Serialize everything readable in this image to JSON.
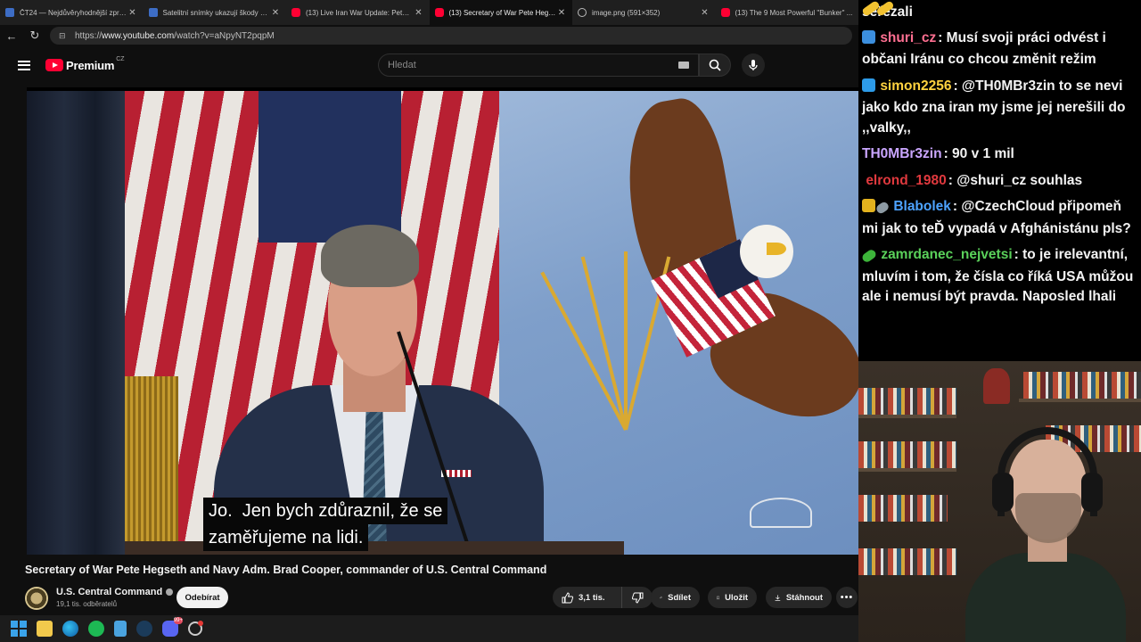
{
  "browser": {
    "tabs": [
      {
        "label": "ČT24 — Nejdůvěryhodnější zpravodajství",
        "icon": "ct24-favicon"
      },
      {
        "label": "Satelitní snímky ukazují škody po ...",
        "icon": "ct24-favicon"
      },
      {
        "label": "(13) Live Iran War Update: Pete Heg...",
        "icon": "youtube-favicon"
      },
      {
        "label": "(13) Secretary of War Pete Hegseth ...",
        "icon": "youtube-favicon",
        "active": true
      },
      {
        "label": "image.png (591×352)",
        "icon": "globe-favicon"
      },
      {
        "label": "(13) The 9 Most Powerful \"Bunker\" ...",
        "icon": "youtube-favicon"
      }
    ],
    "url_prefix": "https://",
    "url_host": "www.youtube.com",
    "url_path": "/watch?v=aNpyNT2pqpM"
  },
  "youtube": {
    "logo_text": "Premium",
    "country_code": "CZ",
    "search_placeholder": "Hledat",
    "video": {
      "subtitle_line1": "Jo.  Jen bych zdůraznil, že se",
      "subtitle_line2": "zaměřujeme na lidi.",
      "title": "Secretary of War Pete Hegseth and Navy Adm. Brad Cooper, commander of U.S. Central Command"
    },
    "channel": {
      "name": "U.S. Central Command",
      "subscribers": "19,1 tis. odběratelů",
      "subscribe_label": "Odebírat"
    },
    "actions": {
      "likes": "3,1 tis.",
      "share": "Sdílet",
      "save": "Uložit",
      "download": "Stáhnout"
    }
  },
  "taskbar": {
    "discord_badge": "99+"
  },
  "chat": {
    "top_fragment": "seřezali",
    "messages": [
      {
        "user": "shuri_cz",
        "color": "#ff6f91",
        "badges": [
          "pick",
          "pill"
        ],
        "text": "Musí svoji práci odvést i občani Iránu co chcou změnit režim"
      },
      {
        "user": "simon2256",
        "color": "#ffd23f",
        "badges": [
          "pill",
          "cube"
        ],
        "text": "@TH0MBr3zin to se nevi jako kdo zna iran my jsme jej nerešili do ,,valky,,"
      },
      {
        "user": "TH0MBr3zin",
        "color": "#caa6ff",
        "badges": [],
        "text": "90 v 1 mil"
      },
      {
        "user": "elrond_1980",
        "color": "#e0393e",
        "badges": [
          "pill"
        ],
        "text": "@shuri_cz souhlas"
      },
      {
        "user": "Blabolek",
        "color": "#4da3ff",
        "badges": [
          "crown",
          "grey"
        ],
        "text": "@CzechCloud připomeň mi jak to teĎ vypadá v Afghánistánu pls?"
      },
      {
        "user": "zamrdanec_nejvetsi",
        "color": "#5ad15a",
        "badges": [
          "green"
        ],
        "text": "to je irelevantní, mluvím i tom, že čísla co říká USA můžou ale i nemusí být pravda. Naposled lhali"
      }
    ]
  }
}
